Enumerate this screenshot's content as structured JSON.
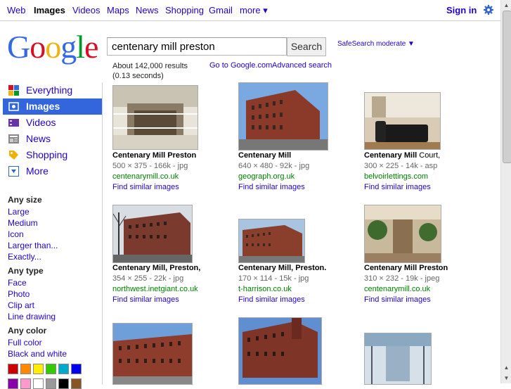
{
  "topnav": {
    "links": [
      "Web",
      "Images",
      "Videos",
      "Maps",
      "News",
      "Shopping",
      "Gmail",
      "more ▾"
    ],
    "sign_in": "Sign in",
    "gear_icon": "gear-icon"
  },
  "logo": "Google",
  "search": {
    "query": "centenary mill preston",
    "button": "Search",
    "safesearch": "SafeSearch moderate ▼"
  },
  "stats": {
    "line1": "About 142,000 results",
    "line2": "(0.13 seconds)",
    "go_google": "Go to Google.com",
    "advanced": "Advanced search"
  },
  "leftnav": [
    {
      "label": "Everything",
      "icon": "everything-icon"
    },
    {
      "label": "Images",
      "icon": "images-icon",
      "active": true
    },
    {
      "label": "Videos",
      "icon": "videos-icon"
    },
    {
      "label": "News",
      "icon": "news-icon"
    },
    {
      "label": "Shopping",
      "icon": "shopping-icon"
    },
    {
      "label": "More",
      "icon": "more-icon"
    }
  ],
  "filters": {
    "size_head": "Any size",
    "size": [
      "Large",
      "Medium",
      "Icon",
      "Larger than...",
      "Exactly..."
    ],
    "type_head": "Any type",
    "type": [
      "Face",
      "Photo",
      "Clip art",
      "Line drawing"
    ],
    "color_head": "Any color",
    "color": [
      "Full color",
      "Black and white"
    ],
    "swatches_row1": [
      "#cc0000",
      "#ff8800",
      "#ffee00",
      "#33cc00",
      "#00aacc",
      "#0000ee"
    ],
    "swatches_row2": [
      "#8800aa",
      "#ff99cc",
      "#ffffff",
      "#999999",
      "#000000",
      "#885522"
    ]
  },
  "results": [
    {
      "title_bold": "Centenary Mill Preston",
      "title_plain": "",
      "meta": "500 × 375 - 166k - jpg",
      "site": "centenarymill.co.uk",
      "similar": "Find similar images"
    },
    {
      "title_bold": "Centenary Mill",
      "title_plain": "",
      "meta": "640 × 480 - 92k - jpg",
      "site": "geograph.org.uk",
      "similar": "Find similar images"
    },
    {
      "title_bold": "Centenary Mill",
      "title_plain": " Court,",
      "meta": "300 × 225 - 14k - asp",
      "site": "belvoirlettings.com",
      "similar": "Find similar images"
    },
    {
      "title_bold": "Centenary Mill, Preston,",
      "title_plain": "",
      "meta": "354 × 255 - 22k - jpg",
      "site": "northwest.inetgiant.co.uk",
      "similar": "Find similar images"
    },
    {
      "title_bold": "Centenary Mill, Preston.",
      "title_plain": "",
      "meta": "170 × 114 - 15k - jpg",
      "site": "t-harrison.co.uk",
      "similar": "Find similar images"
    },
    {
      "title_bold": "Centenary Mill Preston",
      "title_plain": "",
      "meta": "310 × 232 - 19k - jpeg",
      "site": "centenarymill.co.uk",
      "similar": "Find similar images"
    }
  ]
}
